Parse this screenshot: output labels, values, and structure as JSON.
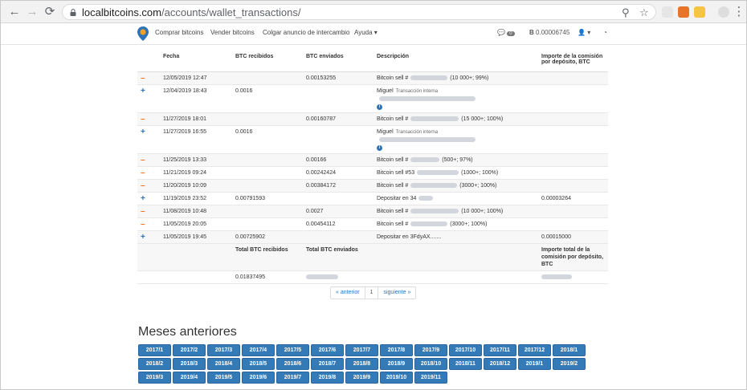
{
  "browser": {
    "url_host": "localbitcoins.com",
    "url_path": "/accounts/wallet_transactions/"
  },
  "nav": {
    "buy": "Comprar bitcoins",
    "sell": "Vender bitcoins",
    "post": "Colgar anuncio de intercambio",
    "help": "Ayuda",
    "messages_count": "0",
    "balance": "0.00006745"
  },
  "table": {
    "headers": [
      "Fecha",
      "BTC recibidos",
      "BTC enviados",
      "Descripción",
      "Importe de la comisión por depósito, BTC"
    ],
    "rows": [
      {
        "sign": "–",
        "date": "12/05/2019 12:47",
        "received": "",
        "sent": "0.00153255",
        "desc": "Bitcoin sell #",
        "desc_tail": "(10 000+; 99%)",
        "fee": ""
      },
      {
        "sign": "+",
        "date": "12/04/2019 18:43",
        "received": "0.0016",
        "sent": "",
        "desc": "Miguel",
        "desc_small": "Transacción interna",
        "fee": ""
      },
      {
        "sign": "–",
        "date": "11/27/2019 18:01",
        "received": "",
        "sent": "0.00160787",
        "desc": "Bitcoin sell #",
        "desc_tail": "(15 000+; 100%)",
        "fee": ""
      },
      {
        "sign": "+",
        "date": "11/27/2019 16:55",
        "received": "0.0016",
        "sent": "",
        "desc": "Miguel",
        "desc_small": "Transacción interna",
        "fee": ""
      },
      {
        "sign": "–",
        "date": "11/25/2019 13:33",
        "received": "",
        "sent": "0.00166",
        "desc": "Bitcoin sell #",
        "desc_tail": "(500+; 97%)",
        "fee": ""
      },
      {
        "sign": "–",
        "date": "11/21/2019 09:24",
        "received": "",
        "sent": "0.00242424",
        "desc": "Bitcoin sell #53",
        "desc_tail": "(1000+; 100%)",
        "fee": ""
      },
      {
        "sign": "–",
        "date": "11/20/2019 10:09",
        "received": "",
        "sent": "0.00384172",
        "desc": "Bitcoin sell #",
        "desc_tail": "(3000+; 100%)",
        "fee": ""
      },
      {
        "sign": "+",
        "date": "11/19/2019 23:52",
        "received": "0.00791593",
        "sent": "",
        "desc": "Depositar en 34",
        "desc_tail": "",
        "fee": "0.00003264"
      },
      {
        "sign": "–",
        "date": "11/08/2019 10:48",
        "received": "",
        "sent": "0.0027",
        "desc": "Bitcoin sell #",
        "desc_tail": "(10 000+; 100%)",
        "fee": ""
      },
      {
        "sign": "–",
        "date": "11/05/2019 20:05",
        "received": "",
        "sent": "0.00454112",
        "desc": "Bitcoin sell #",
        "desc_tail": "(3000+; 100%)",
        "fee": ""
      },
      {
        "sign": "+",
        "date": "11/05/2019 19:45",
        "received": "0.00725902",
        "sent": "",
        "desc": "Depositar en 3FdyAX.......",
        "desc_tail": "",
        "fee": "0.00015000"
      }
    ],
    "totals_headers": {
      "received": "Total BTC recibidos",
      "sent": "Total BTC enviados",
      "fee": "Importe total de la comisión por depósito, BTC"
    },
    "total_received": "0.01837495"
  },
  "pager": {
    "prev": "« anterior",
    "page": "1",
    "next": "siguiente »"
  },
  "months": {
    "title": "Meses anteriores",
    "items": [
      "2017/1",
      "2017/2",
      "2017/3",
      "2017/4",
      "2017/5",
      "2017/6",
      "2017/7",
      "2017/8",
      "2017/9",
      "2017/10",
      "2017/11",
      "2017/12",
      "2018/1",
      "2018/2",
      "2018/3",
      "2018/4",
      "2018/5",
      "2018/6",
      "2018/7",
      "2018/8",
      "2018/9",
      "2018/10",
      "2018/11",
      "2018/12",
      "2019/1",
      "2019/2",
      "2019/3",
      "2019/4",
      "2019/5",
      "2019/6",
      "2019/7",
      "2019/8",
      "2019/9",
      "2019/10",
      "2019/11"
    ]
  },
  "colors": {
    "accent": "#337ab7",
    "minus": "#e8742a",
    "plus": "#2c73b8"
  }
}
